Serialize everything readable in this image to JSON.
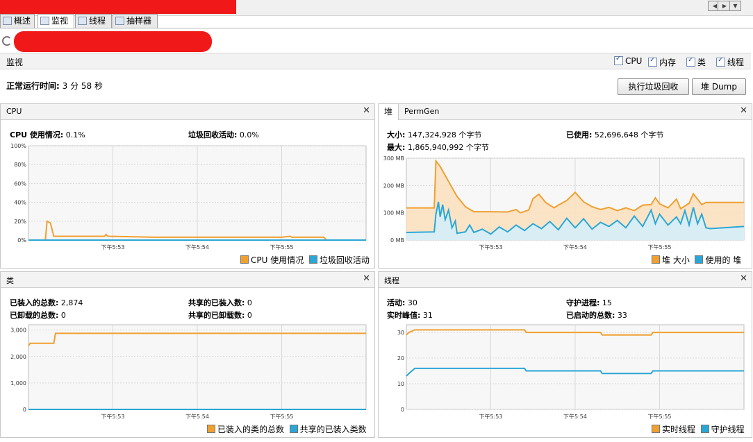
{
  "window": {
    "tabs": [
      {
        "label": "概述",
        "icon": "overview-icon",
        "active": false
      },
      {
        "label": "监视",
        "icon": "monitor-icon",
        "active": true
      },
      {
        "label": "线程",
        "icon": "threads-icon",
        "active": false
      },
      {
        "label": "抽样器",
        "icon": "sampler-icon",
        "active": false
      }
    ]
  },
  "monitor": {
    "section_title": "监视",
    "checkboxes": [
      {
        "label": "CPU",
        "checked": true
      },
      {
        "label": "内存",
        "checked": true
      },
      {
        "label": "类",
        "checked": true
      },
      {
        "label": "线程",
        "checked": true
      }
    ],
    "uptime_label": "正常运行时间:",
    "uptime_value": "3 分 58 秒",
    "gc_button": "执行垃圾回收",
    "heap_dump_button": "堆 Dump"
  },
  "cpu_panel": {
    "title": "CPU",
    "usage_label": "CPU 使用情况:",
    "usage_value": "0.1%",
    "gc_label": "垃圾回收活动:",
    "gc_value": "0.0%",
    "legend": [
      "CPU 使用情况",
      "垃圾回收活动"
    ]
  },
  "heap_panel": {
    "tab_heap": "堆",
    "tab_permgen": "PermGen",
    "size_label": "大小:",
    "size_value": "147,324,928 个字节",
    "max_label": "最大:",
    "max_value": "1,865,940,992 个字节",
    "used_label": "已使用:",
    "used_value": "52,696,648 个字节",
    "legend": [
      "堆 大小",
      "使用的 堆"
    ]
  },
  "classes_panel": {
    "title": "类",
    "loaded_label": "已装入的总数:",
    "loaded_value": "2,874",
    "unloaded_label": "已卸载的总数:",
    "unloaded_value": "0",
    "shared_loaded_label": "共享的已装入数:",
    "shared_loaded_value": "0",
    "shared_unloaded_label": "共享的已卸载数:",
    "shared_unloaded_value": "0",
    "legend": [
      "已装入的类的总数",
      "共享的已装入类数"
    ]
  },
  "threads_panel": {
    "title": "线程",
    "live_label": "活动:",
    "live_value": "30",
    "peak_label": "实时峰值:",
    "peak_value": "31",
    "daemon_label": "守护进程:",
    "daemon_value": "15",
    "started_label": "已启动的总数:",
    "started_value": "33",
    "legend": [
      "实时线程",
      "守护线程"
    ]
  },
  "colors": {
    "orange": "#f0a030",
    "blue": "#2aa7d6",
    "heap_fill": "#fbe0c0",
    "used_fill": "#d5eef8"
  },
  "chart_data": [
    {
      "type": "line",
      "name": "cpu",
      "x_ticks": [
        "下午5:53",
        "下午5:54",
        "下午5:55"
      ],
      "y_ticks": [
        "100%",
        "80%",
        "60%",
        "40%",
        "20%",
        "0%"
      ],
      "ylim": [
        0,
        100
      ],
      "series": [
        {
          "name": "CPU 使用情况",
          "color": "#f0a030",
          "values": [
            [
              0,
              0
            ],
            [
              2,
              0
            ],
            [
              2.2,
              20
            ],
            [
              2.6,
              18
            ],
            [
              3,
              4
            ],
            [
              9,
              4
            ],
            [
              9.2,
              6
            ],
            [
              9.4,
              4
            ],
            [
              15,
              3
            ],
            [
              22,
              3
            ],
            [
              30,
              3
            ],
            [
              31,
              4
            ],
            [
              31.2,
              3
            ],
            [
              35,
              3
            ],
            [
              35.3,
              0
            ]
          ]
        },
        {
          "name": "垃圾回收活动",
          "color": "#2aa7d6",
          "values": [
            [
              0,
              0
            ],
            [
              40,
              0
            ]
          ]
        }
      ],
      "x_tick_positions": [
        10,
        20,
        30
      ]
    },
    {
      "type": "area",
      "name": "heap",
      "x_ticks": [
        "下午5:53",
        "下午5:54",
        "下午5:55"
      ],
      "y_ticks": [
        "300 MB",
        "200 MB",
        "100 MB",
        "0 MB"
      ],
      "ylim": [
        0,
        300
      ],
      "series": [
        {
          "name": "堆 大小",
          "color": "#f0a030",
          "values": [
            [
              0,
              118
            ],
            [
              3.3,
              118
            ],
            [
              3.5,
              290
            ],
            [
              4,
              270
            ],
            [
              5,
              215
            ],
            [
              6,
              160
            ],
            [
              7,
              122
            ],
            [
              8,
              104
            ],
            [
              10,
              104
            ],
            [
              12,
              103
            ],
            [
              13,
              112
            ],
            [
              13.5,
              100
            ],
            [
              14.5,
              110
            ],
            [
              15,
              152
            ],
            [
              15.7,
              168
            ],
            [
              16.5,
              138
            ],
            [
              17.5,
              118
            ],
            [
              18,
              128
            ],
            [
              19,
              145
            ],
            [
              20,
              175
            ],
            [
              21,
              140
            ],
            [
              22,
              122
            ],
            [
              23,
              112
            ],
            [
              24,
              120
            ],
            [
              25,
              108
            ],
            [
              26,
              118
            ],
            [
              27,
              108
            ],
            [
              28,
              128
            ],
            [
              29,
              130
            ],
            [
              29.5,
              155
            ],
            [
              30,
              133
            ],
            [
              31,
              118
            ],
            [
              32,
              150
            ],
            [
              32.5,
              115
            ],
            [
              33.5,
              135
            ],
            [
              34,
              170
            ],
            [
              34.5,
              150
            ],
            [
              35,
              130
            ],
            [
              35.5,
              138
            ],
            [
              40,
              138
            ]
          ]
        },
        {
          "name": "使用的 堆",
          "color": "#2aa7d6",
          "values": [
            [
              0,
              28
            ],
            [
              3.3,
              30
            ],
            [
              3.5,
              95
            ],
            [
              3.8,
              140
            ],
            [
              4,
              85
            ],
            [
              4.3,
              130
            ],
            [
              4.6,
              75
            ],
            [
              5,
              110
            ],
            [
              5.4,
              45
            ],
            [
              5.8,
              70
            ],
            [
              6,
              25
            ],
            [
              7,
              30
            ],
            [
              7.5,
              55
            ],
            [
              8,
              28
            ],
            [
              9,
              40
            ],
            [
              10,
              22
            ],
            [
              11,
              48
            ],
            [
              12,
              30
            ],
            [
              13,
              55
            ],
            [
              14,
              35
            ],
            [
              15,
              60
            ],
            [
              16,
              42
            ],
            [
              17,
              68
            ],
            [
              18,
              38
            ],
            [
              19,
              80
            ],
            [
              20,
              45
            ],
            [
              21,
              78
            ],
            [
              22,
              40
            ],
            [
              23,
              65
            ],
            [
              24,
              50
            ],
            [
              25,
              72
            ],
            [
              26,
              45
            ],
            [
              27,
              88
            ],
            [
              28,
              50
            ],
            [
              29,
              110
            ],
            [
              29.5,
              60
            ],
            [
              30,
              95
            ],
            [
              31,
              55
            ],
            [
              32,
              85
            ],
            [
              32.5,
              60
            ],
            [
              33,
              108
            ],
            [
              33.5,
              55
            ],
            [
              34,
              120
            ],
            [
              34.5,
              60
            ],
            [
              35,
              95
            ],
            [
              35.5,
              45
            ],
            [
              36,
              42
            ],
            [
              40,
              50
            ]
          ]
        }
      ],
      "x_tick_positions": [
        10,
        20,
        30
      ]
    },
    {
      "type": "line",
      "name": "classes",
      "x_ticks": [
        "下午5:53",
        "下午5:54",
        "下午5:55"
      ],
      "y_ticks": [
        "3,000",
        "2,000",
        "1,000",
        "0"
      ],
      "ylim": [
        0,
        3200
      ],
      "series": [
        {
          "name": "已装入的类的总数",
          "color": "#f0a030",
          "values": [
            [
              0,
              2400
            ],
            [
              0.2,
              2500
            ],
            [
              3,
              2500
            ],
            [
              3.2,
              2874
            ],
            [
              40,
              2874
            ]
          ]
        },
        {
          "name": "共享的已装入类数",
          "color": "#2aa7d6",
          "values": [
            [
              0,
              0
            ],
            [
              40,
              0
            ]
          ]
        }
      ],
      "x_tick_positions": [
        10,
        20,
        30
      ]
    },
    {
      "type": "line",
      "name": "threads",
      "x_ticks": [
        "下午5:53",
        "下午5:54",
        "下午5:55"
      ],
      "y_ticks": [
        "30",
        "20",
        "10",
        "0"
      ],
      "ylim": [
        0,
        33
      ],
      "series": [
        {
          "name": "实时线程",
          "color": "#f0a030",
          "values": [
            [
              0,
              29
            ],
            [
              0.3,
              30
            ],
            [
              1,
              31
            ],
            [
              14,
              31
            ],
            [
              14.2,
              30
            ],
            [
              23,
              30
            ],
            [
              23.2,
              29
            ],
            [
              29,
              29
            ],
            [
              29.2,
              30
            ],
            [
              40,
              30
            ]
          ]
        },
        {
          "name": "守护线程",
          "color": "#2aa7d6",
          "values": [
            [
              0,
              13
            ],
            [
              0.3,
              14
            ],
            [
              1,
              16
            ],
            [
              14,
              16
            ],
            [
              14.2,
              15
            ],
            [
              23,
              15
            ],
            [
              23.2,
              14
            ],
            [
              29,
              14
            ],
            [
              29.2,
              15
            ],
            [
              40,
              15
            ]
          ]
        }
      ],
      "x_tick_positions": [
        10,
        20,
        30
      ]
    }
  ]
}
